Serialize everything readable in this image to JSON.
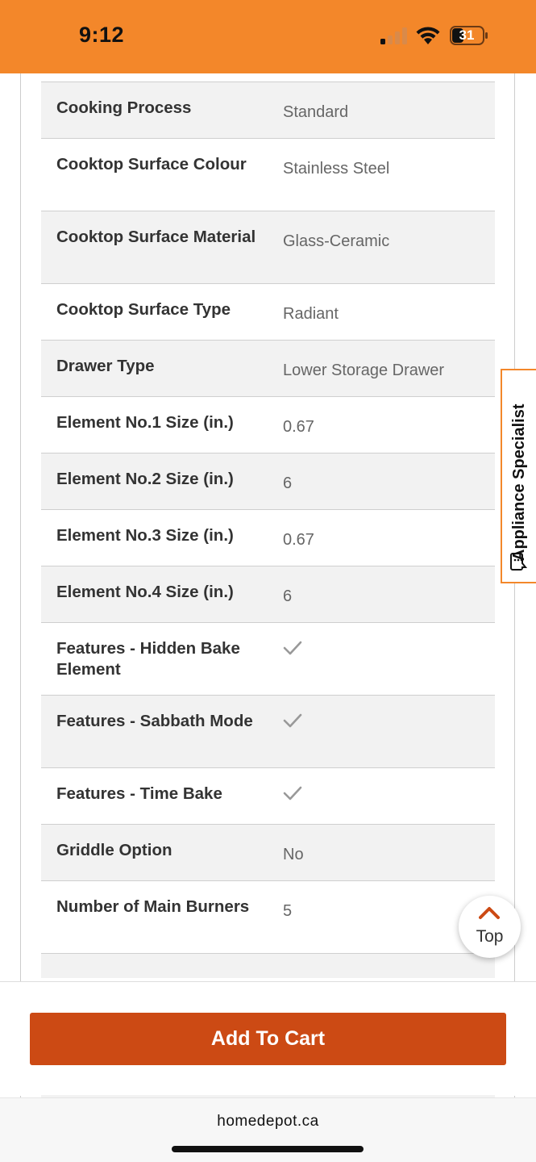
{
  "status_bar": {
    "time": "9:12",
    "battery_level": "31",
    "accent_color": "#f3872a"
  },
  "spec_table": {
    "rows": [
      {
        "label": "Cooking Process",
        "value": "Standard",
        "check": false
      },
      {
        "label": "Cooktop Surface Colour",
        "value": "Stainless Steel",
        "check": false
      },
      {
        "label": "Cooktop Surface Material",
        "value": "Glass-Ceramic",
        "check": false
      },
      {
        "label": "Cooktop Surface Type",
        "value": "Radiant",
        "check": false
      },
      {
        "label": "Drawer Type",
        "value": "Lower Storage Drawer",
        "check": false
      },
      {
        "label": "Element No.1 Size (in.)",
        "value": "0.67",
        "check": false
      },
      {
        "label": "Element No.2 Size (in.)",
        "value": "6",
        "check": false
      },
      {
        "label": "Element No.3 Size (in.)",
        "value": "0.67",
        "check": false
      },
      {
        "label": "Element No.4 Size (in.)",
        "value": "6",
        "check": false
      },
      {
        "label": "Features - Hidden Bake Element",
        "value": "",
        "check": true,
        "icon": "checkmark-icon"
      },
      {
        "label": "Features - Sabbath Mode",
        "value": "",
        "check": true,
        "icon": "checkmark-icon"
      },
      {
        "label": "Features - Time Bake",
        "value": "",
        "check": true,
        "icon": "checkmark-icon"
      },
      {
        "label": "Griddle Option",
        "value": "No",
        "check": false
      },
      {
        "label": "Number of Main Burners",
        "value": "5",
        "check": false
      }
    ]
  },
  "specialist_tab": {
    "label": "Appliance Specialist",
    "icon": "chat-bubble-icon"
  },
  "top_button": {
    "label": "Top",
    "icon": "chevron-up-icon"
  },
  "cart": {
    "button_label": "Add To Cart",
    "button_color": "#cc4a14"
  },
  "browser": {
    "url": "homedepot.ca"
  }
}
